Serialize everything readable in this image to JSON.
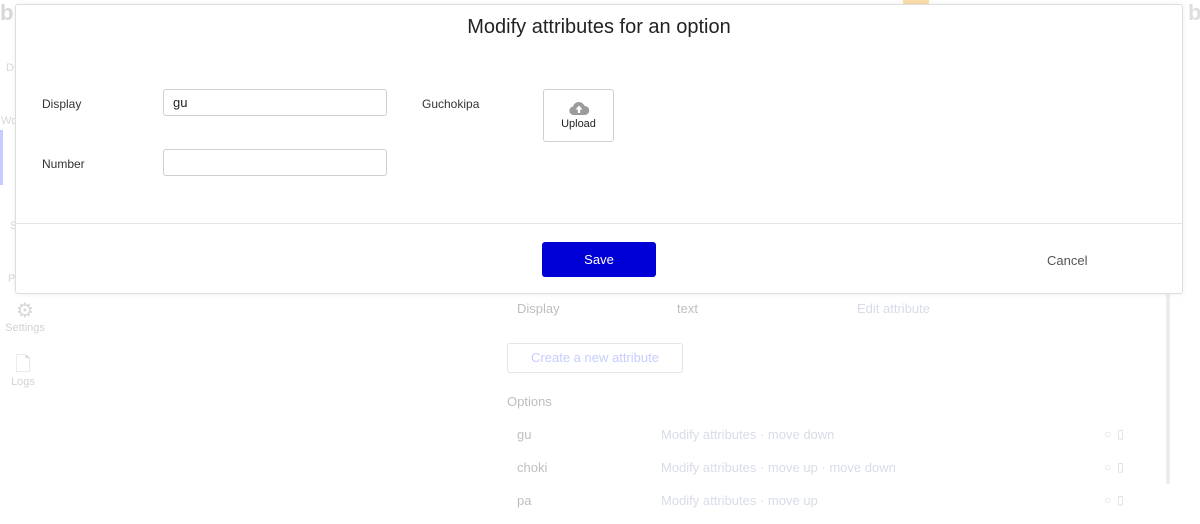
{
  "modal": {
    "title": "Modify attributes for an option",
    "fields": {
      "display_label": "Display",
      "display_value": "gu",
      "number_label": "Number",
      "number_value": "",
      "image_label": "Guchokipa",
      "upload_label": "Upload"
    },
    "save_label": "Save",
    "cancel_label": "Cancel"
  },
  "background": {
    "nav": {
      "settings_label": "Settings",
      "logs_label": "Logs",
      "frag_d": "D",
      "frag_wo": "Wo",
      "frag_s": "S",
      "frag_p": "P"
    },
    "attribute_row": {
      "name": "Display",
      "type": "text",
      "action": "Edit attribute"
    },
    "create_attribute_label": "Create a new attribute",
    "options_heading": "Options",
    "options": [
      {
        "name": "gu",
        "action": "Modify attributes · move down"
      },
      {
        "name": "choki",
        "action": "Modify attributes · move up · move down"
      },
      {
        "name": "pa",
        "action": "Modify attributes · move up"
      }
    ]
  },
  "colors": {
    "save_button": "#0000d6",
    "modal_border": "#dedede",
    "accent_link": "#6b7cff"
  },
  "icons": {
    "upload": "cloud-upload-icon",
    "settings": "gear-icon",
    "logs": "document-icon"
  }
}
